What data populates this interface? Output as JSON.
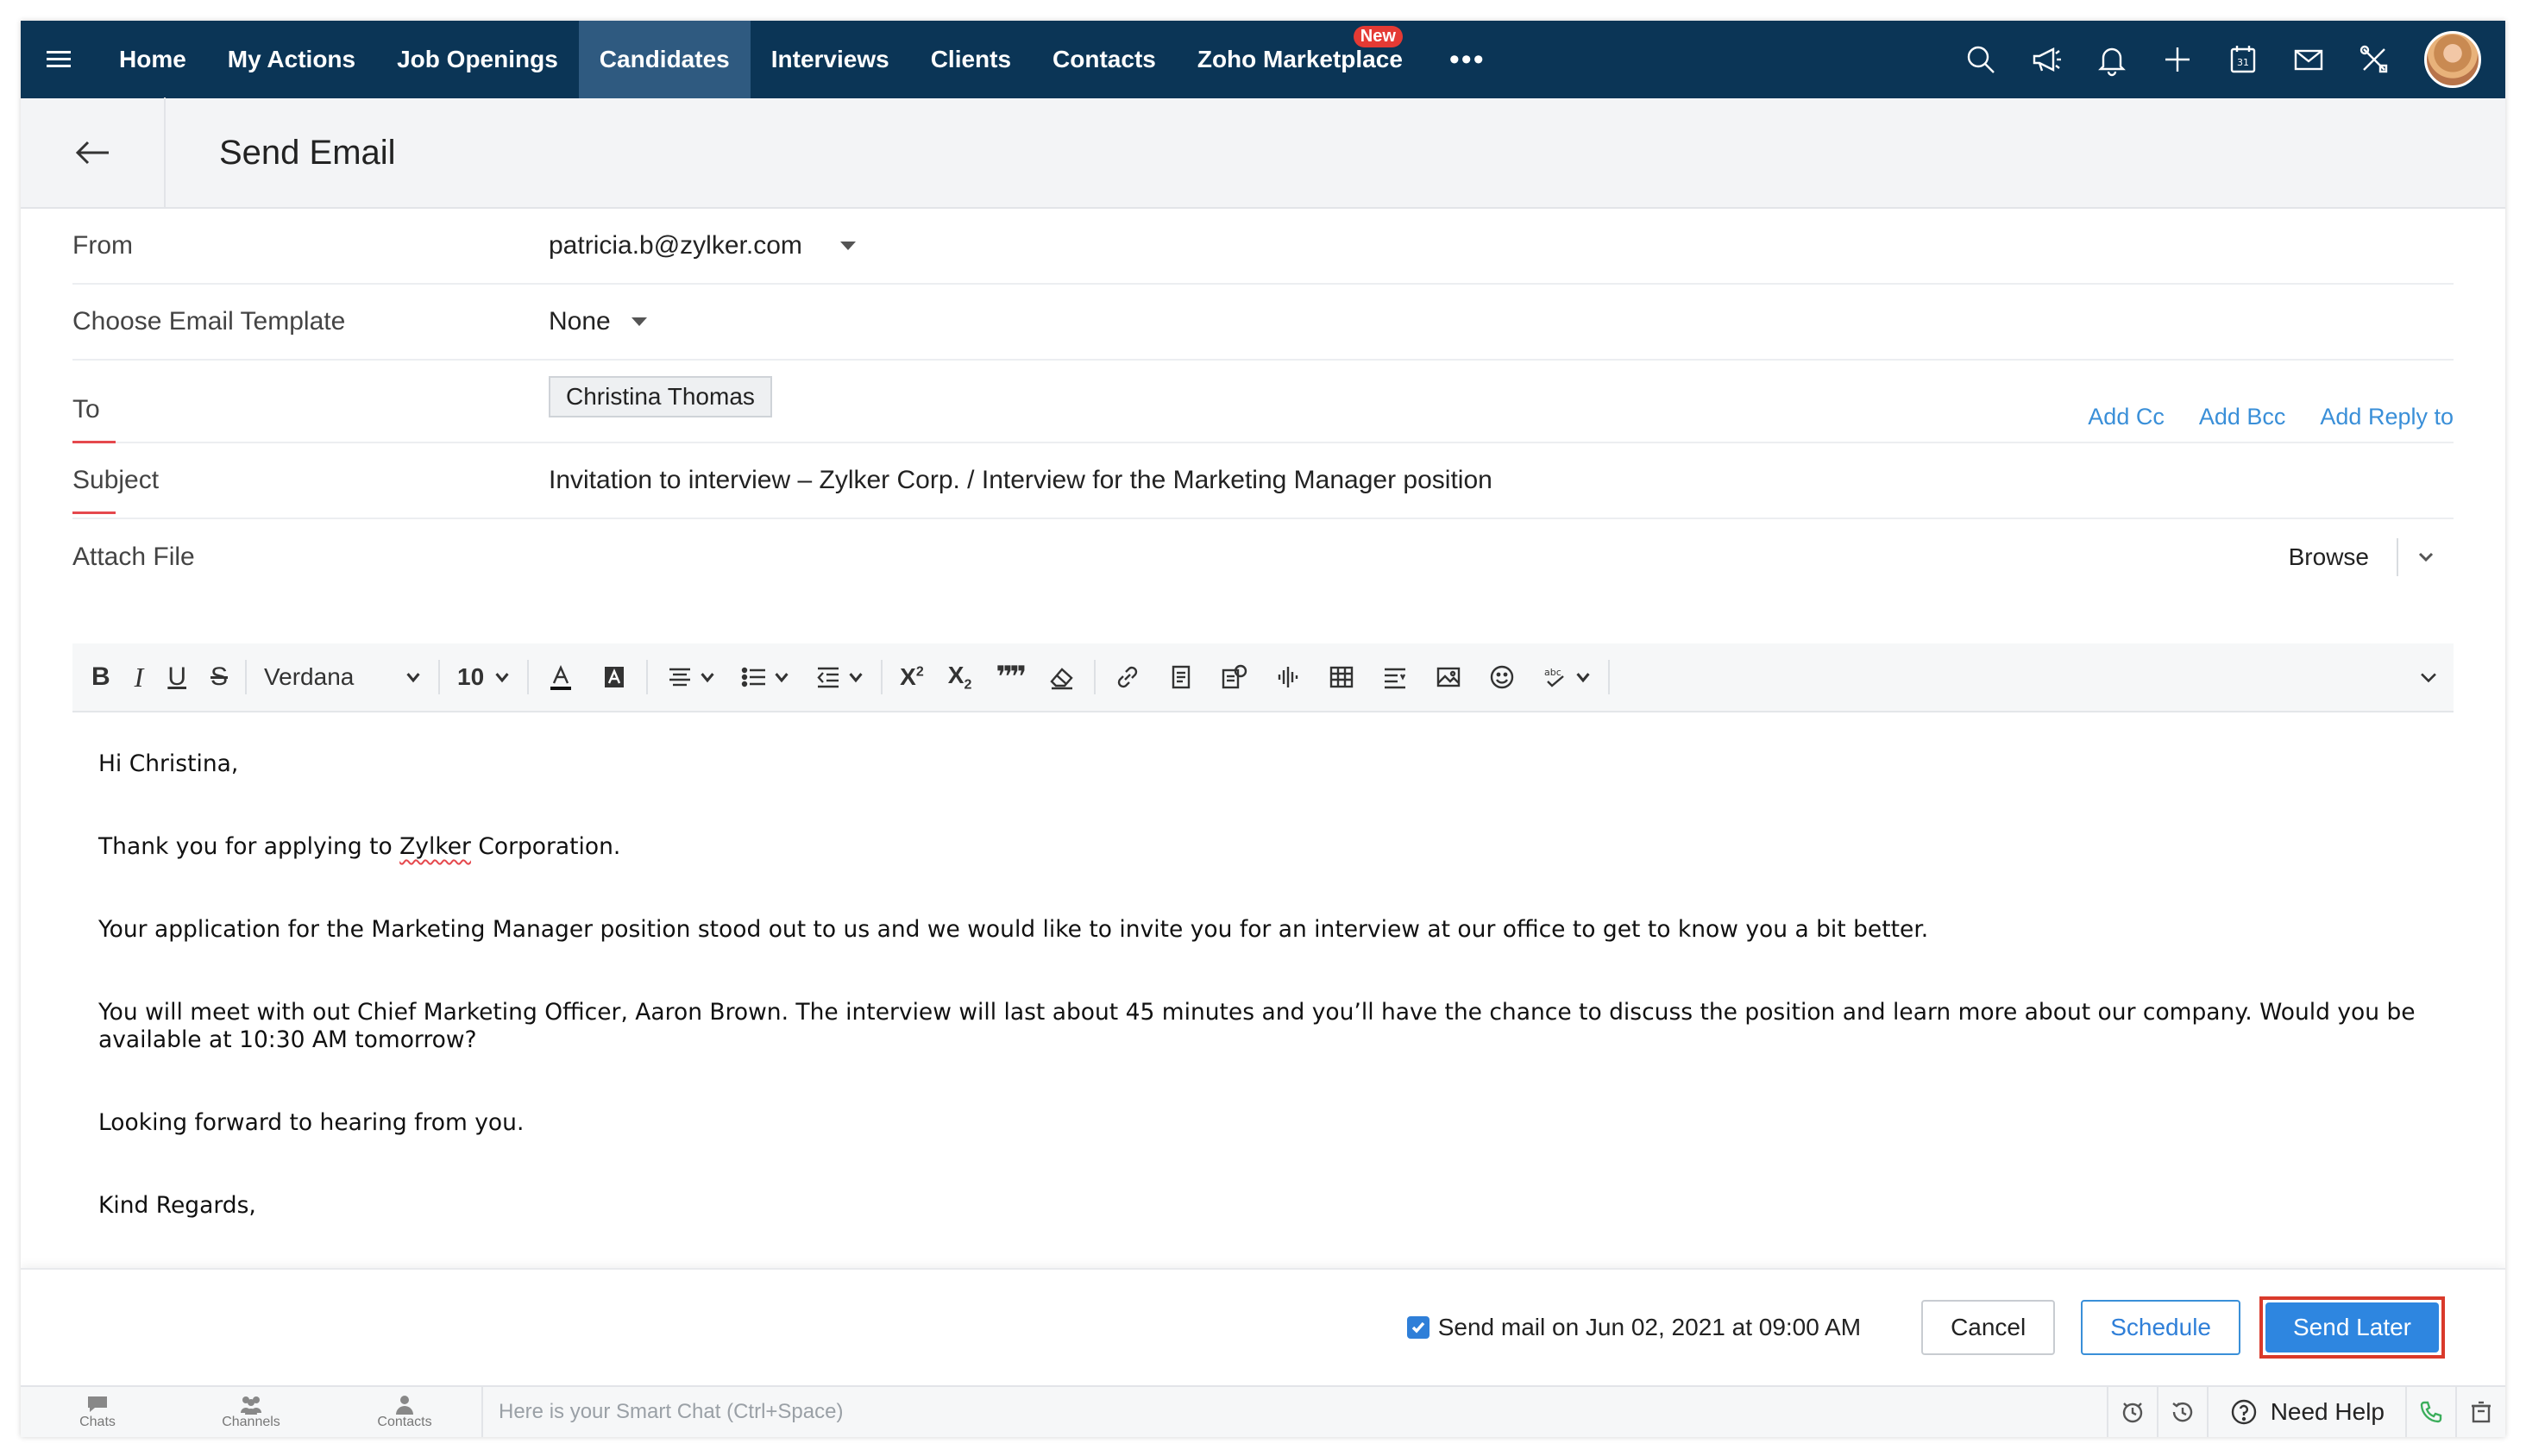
{
  "nav": {
    "items": [
      {
        "label": "Home",
        "active": false
      },
      {
        "label": "My Actions",
        "active": false
      },
      {
        "label": "Job Openings",
        "active": false
      },
      {
        "label": "Candidates",
        "active": true
      },
      {
        "label": "Interviews",
        "active": false
      },
      {
        "label": "Clients",
        "active": false
      },
      {
        "label": "Contacts",
        "active": false
      },
      {
        "label": "Zoho Marketplace",
        "active": false,
        "badge": "New"
      }
    ],
    "more": "•••",
    "icons": [
      "search-icon",
      "megaphone-icon",
      "bell-icon",
      "plus-icon",
      "calendar-icon",
      "mail-icon",
      "tools-icon"
    ],
    "calendar_day": "31"
  },
  "header": {
    "title": "Send Email"
  },
  "form": {
    "from_label": "From",
    "from_value": "patricia.b@zylker.com",
    "template_label": "Choose Email Template",
    "template_value": "None",
    "to_label": "To",
    "to_chip": "Christina Thomas",
    "add_cc": "Add Cc",
    "add_bcc": "Add Bcc",
    "add_reply_to": "Add Reply to",
    "subject_label": "Subject",
    "subject_value": "Invitation to interview – Zylker Corp. / Interview for the Marketing Manager position",
    "attach_label": "Attach File",
    "browse": "Browse"
  },
  "toolbar": {
    "font": "Verdana",
    "size": "10"
  },
  "body": {
    "greeting": "Hi Christina,",
    "line1_pre": "Thank you for applying to ",
    "line1_word": "Zylker",
    "line1_post": " Corporation.",
    "line2": "Your application for the Marketing Manager position stood out to us and we would like to invite you for an interview at our office to get to know you a bit better.",
    "line3": "You will meet with out Chief Marketing Officer, Aaron Brown. The interview will last about 45 minutes and you’ll have the chance to discuss the position and learn more about our company. Would you be available at 10:30 AM tomorrow?",
    "line4": "Looking forward to hearing from you.",
    "line5": "Kind Regards,"
  },
  "actions": {
    "send_mail_text": "Send mail on Jun 02, 2021 at 09:00 AM",
    "send_mail_checked": true,
    "cancel": "Cancel",
    "schedule": "Schedule",
    "send_later": "Send Later"
  },
  "chatbar": {
    "chats": "Chats",
    "channels": "Channels",
    "contacts": "Contacts",
    "placeholder": "Here is your Smart Chat (Ctrl+Space)",
    "need_help": "Need Help"
  },
  "colors": {
    "nav_bg": "#0b3556",
    "nav_active": "#2f5a80",
    "accent": "#2e86e0",
    "highlight_border": "#d93a2b",
    "link": "#3a8fd8"
  }
}
